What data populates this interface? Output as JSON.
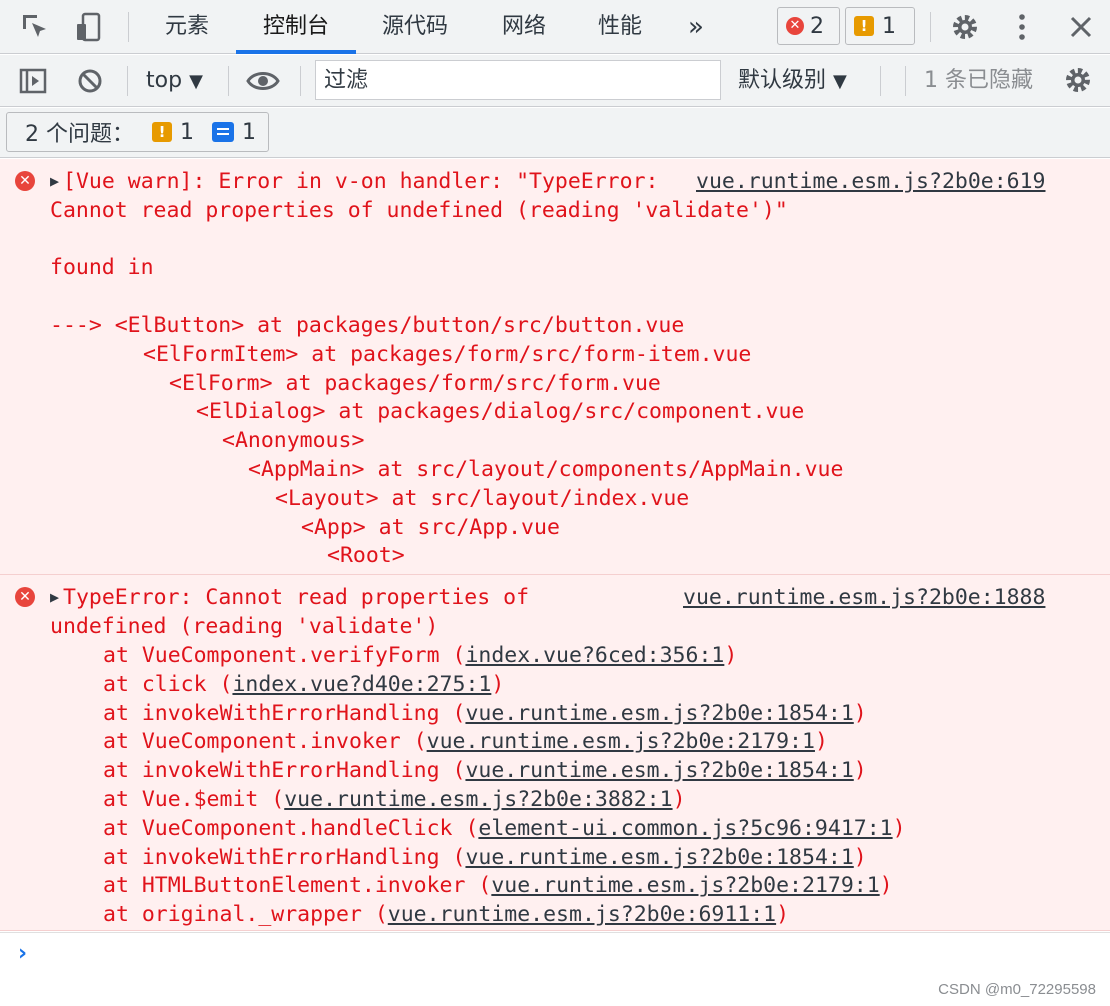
{
  "tabs": [
    {
      "label": "元素"
    },
    {
      "label": "控制台"
    },
    {
      "label": "源代码"
    },
    {
      "label": "网络"
    },
    {
      "label": "性能"
    }
  ],
  "more_tabs": "»",
  "error_count": "2",
  "warning_count": "1",
  "toolbar": {
    "context": "top",
    "filter_placeholder": "过滤",
    "level": "默认级别",
    "hidden": "1 条已隐藏"
  },
  "issues": {
    "label": "2 个问题：",
    "warnings": "1",
    "infos": "1"
  },
  "msg1": {
    "line1": "[Vue warn]: Error in v-on handler: \"TypeError: ",
    "line2": "Cannot read properties of undefined (reading 'validate')\"",
    "line3": "found in",
    "source": "vue.runtime.esm.js?2b0e:619",
    "tree": [
      "---> <ElButton> at packages/button/src/button.vue",
      "<ElFormItem> at packages/form/src/form-item.vue",
      "<ElForm> at packages/form/src/form.vue",
      "<ElDialog> at packages/dialog/src/component.vue",
      "<Anonymous>",
      "<AppMain> at src/layout/components/AppMain.vue",
      "<Layout> at src/layout/index.vue",
      "<App> at src/App.vue",
      "<Root>"
    ]
  },
  "msg2": {
    "line1": "TypeError: Cannot read properties of",
    "line2": "undefined (reading 'validate')",
    "source": "vue.runtime.esm.js?2b0e:1888",
    "stack": [
      {
        "fn": "at VueComponent.verifyForm ",
        "loc": "index.vue?6ced:356:1"
      },
      {
        "fn": "at click ",
        "loc": "index.vue?d40e:275:1"
      },
      {
        "fn": "at invokeWithErrorHandling ",
        "loc": "vue.runtime.esm.js?2b0e:1854:1"
      },
      {
        "fn": "at VueComponent.invoker ",
        "loc": "vue.runtime.esm.js?2b0e:2179:1"
      },
      {
        "fn": "at invokeWithErrorHandling ",
        "loc": "vue.runtime.esm.js?2b0e:1854:1"
      },
      {
        "fn": "at Vue.$emit ",
        "loc": "vue.runtime.esm.js?2b0e:3882:1"
      },
      {
        "fn": "at VueComponent.handleClick ",
        "loc": "element-ui.common.js?5c96:9417:1"
      },
      {
        "fn": "at invokeWithErrorHandling ",
        "loc": "vue.runtime.esm.js?2b0e:1854:1"
      },
      {
        "fn": "at HTMLButtonElement.invoker ",
        "loc": "vue.runtime.esm.js?2b0e:2179:1"
      },
      {
        "fn": "at original._wrapper ",
        "loc": "vue.runtime.esm.js?2b0e:6911:1"
      }
    ]
  },
  "prompt": "›",
  "watermark": "CSDN @m0_72295598",
  "colors": {
    "error": "#e0131b",
    "error_bg": "#fff0f0",
    "accent": "#1a73e8",
    "warning": "#e79a00"
  }
}
